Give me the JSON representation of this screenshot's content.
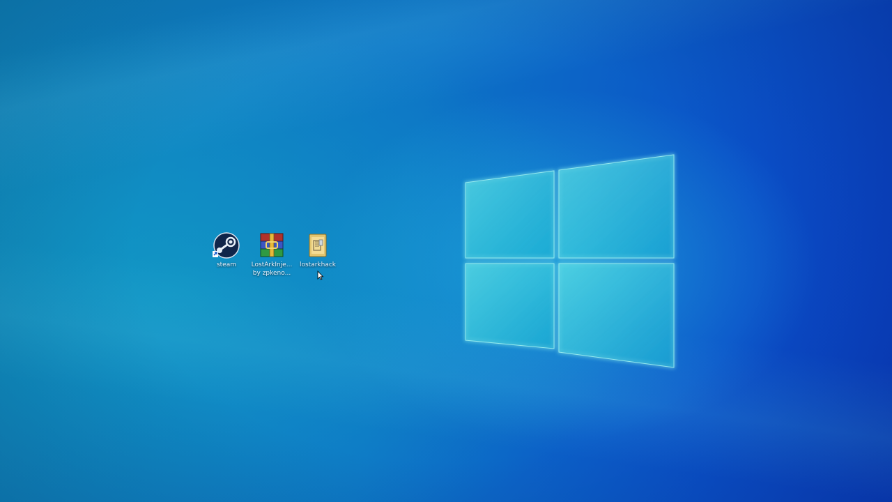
{
  "desktop": {
    "wallpaper": "windows-10-hero",
    "colors": {
      "bg_left": "#0f86bd",
      "bg_right": "#0a3dc0",
      "logo_pane": "#3fc9d8"
    },
    "icons": [
      {
        "label": "steam",
        "icon": "steam-icon"
      },
      {
        "label": "LostArkInje...\nby zpkeno...",
        "icon": "winrar-archive-icon"
      },
      {
        "label": "lostarkhack",
        "icon": "folder-icon"
      }
    ]
  }
}
